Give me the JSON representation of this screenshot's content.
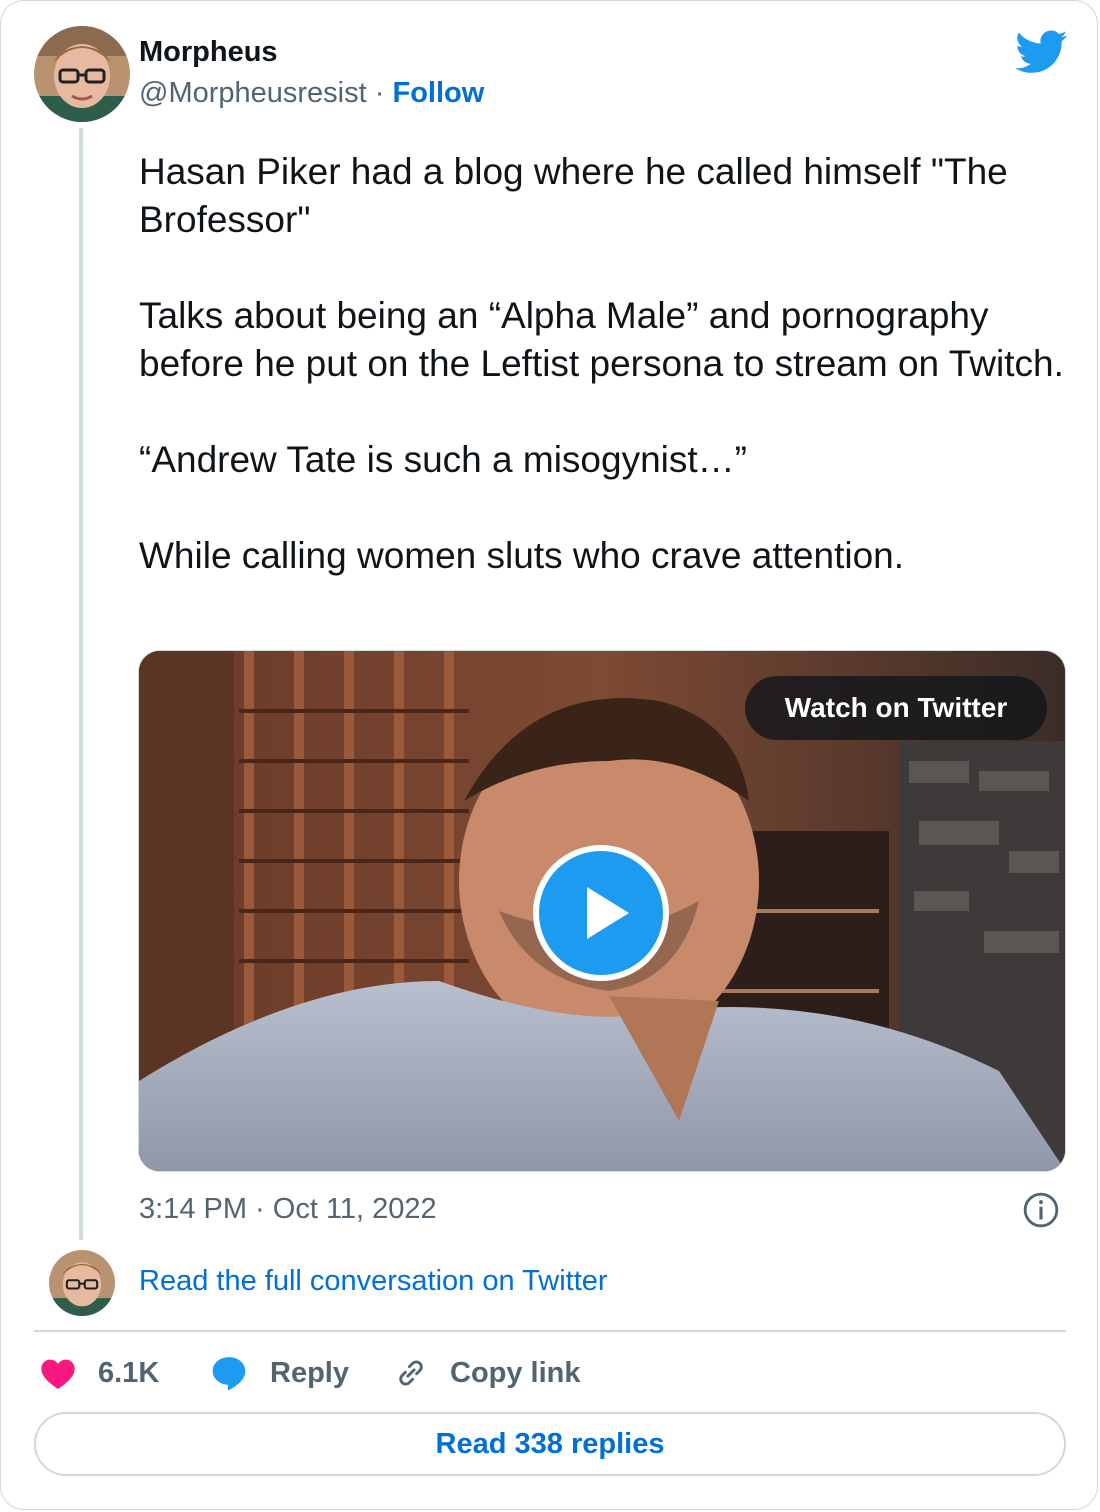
{
  "author": {
    "name": "Morpheus",
    "handle": "@Morpheusresist",
    "separator": "·",
    "follow_label": "Follow"
  },
  "tweet": {
    "paragraphs": [
      "Hasan Piker had a blog where he called himself \"The Brofessor\"",
      "Talks about being an “Alpha Male” and pornography before he put on the Leftist persona to stream on Twitch.",
      "“Andrew Tate is such a misogynist…”",
      "While calling women sluts who crave attention."
    ],
    "timestamp": "3:14 PM · Oct 11, 2022"
  },
  "media": {
    "watch_label": "Watch on Twitter",
    "play_icon": "play-icon"
  },
  "conversation": {
    "read_label": "Read the full conversation on Twitter"
  },
  "actions": {
    "like_count": "6.1K",
    "reply_label": "Reply",
    "copy_label": "Copy link"
  },
  "footer": {
    "read_replies_label": "Read 338 replies"
  },
  "colors": {
    "brand": "#1d9bf0",
    "link": "#006fd6",
    "like": "#f91880",
    "muted": "#536471",
    "border": "#cfd9de"
  },
  "icons": [
    "twitter-bird-icon",
    "info-icon",
    "heart-icon",
    "reply-bubble-icon",
    "link-icon",
    "play-icon"
  ]
}
